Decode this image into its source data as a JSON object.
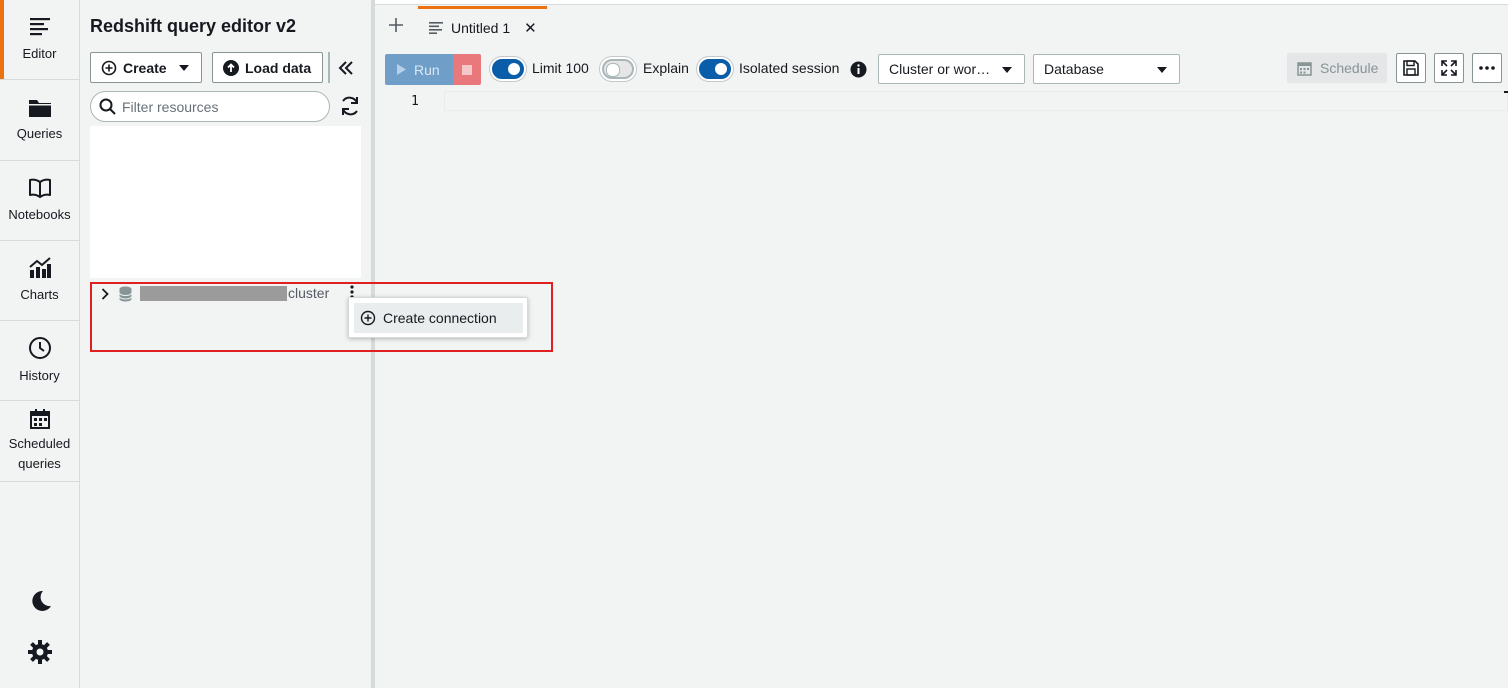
{
  "rail": {
    "items": [
      {
        "label": "Editor",
        "icon": "editor-icon"
      },
      {
        "label": "Queries",
        "icon": "folder-icon"
      },
      {
        "label": "Notebooks",
        "icon": "book-icon"
      },
      {
        "label": "Charts",
        "icon": "chart-icon"
      },
      {
        "label": "History",
        "icon": "clock-icon"
      },
      {
        "label": "Scheduled queries",
        "icon": "calendar-icon"
      }
    ],
    "bottom_icons": [
      "moon-icon",
      "gear-icon"
    ]
  },
  "panel": {
    "title": "Redshift query editor v2",
    "create_label": "Create",
    "load_data_label": "Load data",
    "filter_placeholder": "Filter resources",
    "tree": {
      "node_suffix": "cluster"
    },
    "context_menu": {
      "item_label": "Create connection"
    }
  },
  "editor": {
    "tab_label": "Untitled 1",
    "run_label": "Run",
    "limit_label": "Limit 100",
    "explain_label": "Explain",
    "isolated_label": "Isolated session",
    "cluster_select": "Cluster or wor…",
    "database_select": "Database",
    "schedule_label": "Schedule",
    "line_number": "1",
    "toggles": {
      "limit": true,
      "explain": false,
      "isolated": true
    }
  },
  "colors": {
    "accent": "#ec7211",
    "primary_blue": "#0a5da8",
    "highlight": "#e02020"
  }
}
